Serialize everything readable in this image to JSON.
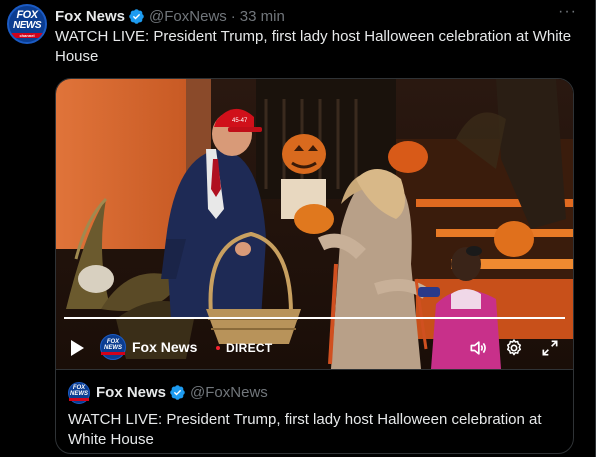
{
  "post": {
    "author_name": "Fox News",
    "author_handle": "@FoxNews",
    "separator": "·",
    "time": "33 min",
    "more_label": "···",
    "text": "WATCH LIVE: President Trump, first lady host Halloween celebration at White House",
    "avatar": {
      "logo_line1": "FOX",
      "logo_line2": "NEWS",
      "logo_line3": "channel"
    }
  },
  "video": {
    "channel_name": "Fox News",
    "live_label": "DIRECT",
    "progress": 1.0,
    "cap_text": "45-47",
    "controls": {
      "play_icon": "play-icon",
      "volume_icon": "volume-icon",
      "settings_icon": "gear-icon",
      "fullscreen_icon": "expand-icon"
    }
  },
  "quote": {
    "author_name": "Fox News",
    "author_handle": "@FoxNews",
    "text": "WATCH LIVE: President Trump, first lady host Halloween celebration at White House"
  },
  "colors": {
    "background": "#000000",
    "text_primary": "#e7e9ea",
    "text_secondary": "#71767b",
    "border": "#2f3336",
    "verified_blue": "#1d9bf0",
    "fox_blue": "#0b3d91",
    "fox_red": "#d0021b",
    "live_red": "#f4212e"
  }
}
